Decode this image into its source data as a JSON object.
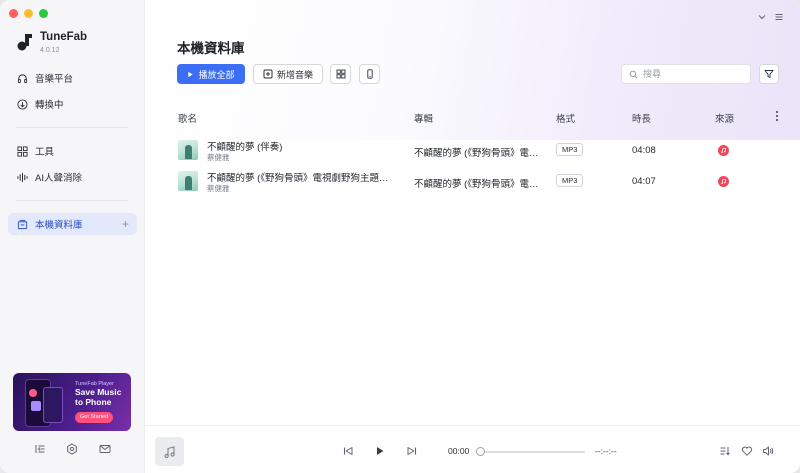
{
  "app": {
    "name": "TuneFab",
    "version": "4.0.12"
  },
  "colors": {
    "accent": "#3b6ef5",
    "active_bg": "#e3e9fb",
    "apple_music": "#f0455a"
  },
  "sidebar": {
    "items": [
      {
        "label": "音樂平台",
        "icon": "headphones-icon"
      },
      {
        "label": "轉換中",
        "icon": "download-circle-icon"
      },
      {
        "label": "工具",
        "icon": "grid-icon"
      },
      {
        "label": "AI人聲消除",
        "icon": "waveform-icon"
      },
      {
        "label": "本機資料庫",
        "icon": "library-icon",
        "active": true
      }
    ],
    "promo": {
      "brand": "TuneFab Player",
      "headline": "Save Music to Phone",
      "cta": "Get Started"
    }
  },
  "main": {
    "title": "本機資料庫",
    "toolbar": {
      "play_all": "播放全部",
      "add_music": "新增音樂",
      "search_placeholder": "搜尋"
    },
    "columns": {
      "song": "歌名",
      "album": "專輯",
      "format": "格式",
      "duration": "時長",
      "source": "來源"
    },
    "rows": [
      {
        "title": "不顧醒的夢 (伴奏)",
        "artist": "蔡健雅",
        "album": "不顧醒的夢 (《野狗骨頭》電…",
        "format": "MP3",
        "duration": "04:08"
      },
      {
        "title": "不顧醒的夢 (《野狗骨頭》電視劇野狗主題…",
        "artist": "蔡健雅",
        "album": "不顧醒的夢 (《野狗骨頭》電…",
        "format": "MP3",
        "duration": "04:07"
      }
    ]
  },
  "player": {
    "current_time": "00:00",
    "total_time": "--:--:--",
    "progress": 0
  }
}
